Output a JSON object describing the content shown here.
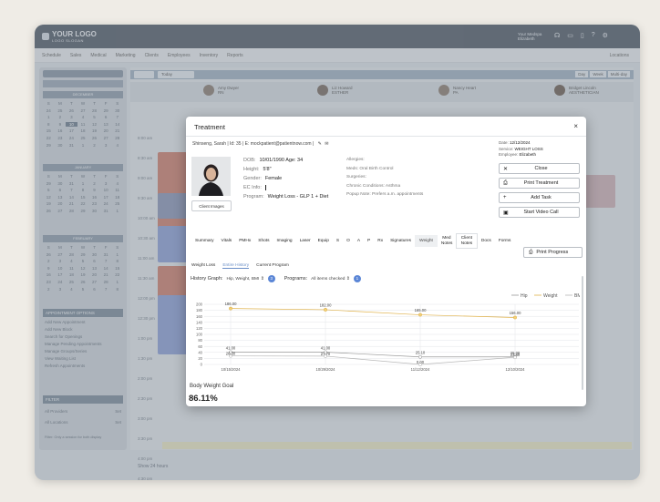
{
  "header": {
    "logo": "YOUR LOGO",
    "logo_sub": "LOGO SLOGAN",
    "user_line1": "Your Medspa",
    "user_line2": "Elizabeth"
  },
  "nav": {
    "items": [
      "Schedule",
      "Sales",
      "Medical",
      "Marketing",
      "Clients",
      "Employees",
      "Inventory",
      "Reports"
    ],
    "locations": "Locations"
  },
  "calendar": {
    "months": [
      {
        "name": "DECEMBER",
        "days": [
          "S",
          "M",
          "T",
          "W",
          "T",
          "F",
          "S",
          "24",
          "25",
          "26",
          "27",
          "28",
          "29",
          "30",
          "1",
          "2",
          "3",
          "4",
          "5",
          "6",
          "7",
          "8",
          "9",
          "10",
          "11",
          "12",
          "13",
          "14",
          "15",
          "16",
          "17",
          "18",
          "19",
          "20",
          "21",
          "22",
          "23",
          "24",
          "25",
          "26",
          "27",
          "28",
          "29",
          "30",
          "31",
          "1",
          "2",
          "3",
          "4"
        ]
      },
      {
        "name": "JANUARY",
        "days": [
          "S",
          "M",
          "T",
          "W",
          "T",
          "F",
          "S",
          "29",
          "30",
          "31",
          "1",
          "2",
          "3",
          "4",
          "5",
          "6",
          "7",
          "8",
          "9",
          "10",
          "11",
          "12",
          "13",
          "14",
          "15",
          "16",
          "17",
          "18",
          "19",
          "20",
          "21",
          "22",
          "23",
          "24",
          "25",
          "26",
          "27",
          "28",
          "29",
          "30",
          "31",
          "1"
        ]
      },
      {
        "name": "FEBRUARY",
        "days": [
          "S",
          "M",
          "T",
          "W",
          "T",
          "F",
          "S",
          "26",
          "27",
          "28",
          "29",
          "30",
          "31",
          "1",
          "2",
          "3",
          "4",
          "5",
          "6",
          "7",
          "8",
          "9",
          "10",
          "11",
          "12",
          "13",
          "14",
          "15",
          "16",
          "17",
          "18",
          "19",
          "20",
          "21",
          "22",
          "23",
          "24",
          "25",
          "26",
          "27",
          "28",
          "1",
          "2",
          "3",
          "4",
          "5",
          "6",
          "7",
          "8"
        ]
      }
    ],
    "quick_actions_title": "APPOINTMENT OPTIONS",
    "quick_actions": [
      "Add New Appointment",
      "Add New Block",
      "Search for Openings",
      "Manage Pending Appointments",
      "Manage Groups/Series",
      "View Waiting List",
      "Refresh Appointments"
    ],
    "filter_title": "FILTER",
    "filter_rows": [
      {
        "label": "All Providers",
        "action": "Set"
      },
      {
        "label": "All Locations",
        "action": "Set"
      }
    ],
    "filter_note": "Filter: Only a session for both display"
  },
  "schedule": {
    "today": "Today",
    "view_buttons": [
      "Day",
      "Week",
      "Multi-day"
    ],
    "providers": [
      {
        "name": "Amy Dwyer",
        "role": "RN"
      },
      {
        "name": "Liz Howard",
        "role": "ESTHER"
      },
      {
        "name": "Nancy Heart",
        "role": "PA"
      },
      {
        "name": "Bridget Lincoln",
        "role": "AESTHETICIAN"
      }
    ],
    "times": [
      "8:00 am",
      "8:30 am",
      "9:00 am",
      "9:30 am",
      "10:00 am",
      "10:30 am",
      "11:00 am",
      "11:30 am",
      "12:00 pm",
      "12:30 pm",
      "1:00 pm",
      "1:30 pm",
      "2:00 pm",
      "2:30 pm",
      "3:00 pm",
      "3:30 pm",
      "4:00 pm",
      "4:30 pm"
    ],
    "show_more": "Show 24 hours"
  },
  "modal": {
    "title": "Treatment",
    "patient_line": "Shinseng, Sarah | Id: 35 | E: mockpatient@patientnow.com |",
    "dob_label": "DOB:",
    "dob": "10/01/1990 Age: 34",
    "height_label": "Height:",
    "height": "5'8\"",
    "gender_label": "Gender:",
    "gender": "Female",
    "ec_label": "EC Info:",
    "ec": "",
    "program_label": "Program:",
    "program": "Weight Loss - GLP 1 + Diet",
    "client_images": "Client Images",
    "medical": [
      "Allergies:",
      "Meds: Oral Birth Control",
      "Surgeries:",
      "Chronic Conditions: Asthma",
      "Popup Note: Prefers a.m. appointments"
    ],
    "date_label": "Date:",
    "date": "12/12/2024",
    "service_label": "Service:",
    "service": "WEIGHT LOSS",
    "employee_label": "Employee:",
    "employee": "Elizabeth",
    "actions": [
      {
        "icon": "close-x",
        "label": "Close"
      },
      {
        "icon": "printer",
        "label": "Print Treatment"
      },
      {
        "icon": "plus",
        "label": "Add Task"
      },
      {
        "icon": "video",
        "label": "Start Video Call"
      }
    ],
    "tabs": [
      "Summary",
      "Vitals",
      "PMHx",
      "Shots",
      "Imaging",
      "Laser",
      "Equip",
      "S",
      "O",
      "A",
      "P",
      "Rx",
      "Signatures",
      "Weight",
      "Med Notes",
      "Client Notes",
      "Docs",
      "Forms"
    ],
    "active_tab": "Weight",
    "print_progress": "Print Progress",
    "subtabs": [
      "Weight Loss",
      "Entire History",
      "Current Program"
    ],
    "active_subtab": "Entire History",
    "history_label": "History Graph:",
    "history_value": "Hip, Weight, BMI",
    "history_count": "3",
    "programs_label": "Programs:",
    "programs_value": "All items checked",
    "programs_count": "1",
    "goal_label": "Body Weight Goal",
    "goal_value": "86.11%"
  },
  "chart_data": {
    "type": "line",
    "legend": [
      "Hip",
      "Weight",
      "BMI"
    ],
    "legend_position": "top-right",
    "grid": true,
    "ylim": [
      0,
      200
    ],
    "y_ticks": [
      0,
      20,
      40,
      60,
      80,
      100,
      120,
      140,
      160,
      180,
      200
    ],
    "categories": [
      "10/15/2024",
      "10/29/2024",
      "11/12/2024",
      "12/10/2024"
    ],
    "series": [
      {
        "name": "Hip",
        "values": [
          41.0,
          41.0,
          25.1,
          25.0
        ],
        "labels": [
          "41.00",
          "41.00",
          "25.10",
          "25.00"
        ]
      },
      {
        "name": "Weight",
        "values": [
          186.0,
          182.0,
          165.0,
          156.0
        ],
        "labels": [
          "186.00",
          "182.00",
          "165.00",
          "156.00"
        ]
      },
      {
        "name": "BMI",
        "values": [
          28.3,
          27.7,
          0.0,
          23.6
        ],
        "labels": [
          "28.30",
          "27.70",
          "0.00",
          "23.60"
        ]
      }
    ],
    "colors": {
      "Hip": "#9a9a9a",
      "Weight": "#e0b24a",
      "BMI": "#b8b8b8"
    }
  }
}
